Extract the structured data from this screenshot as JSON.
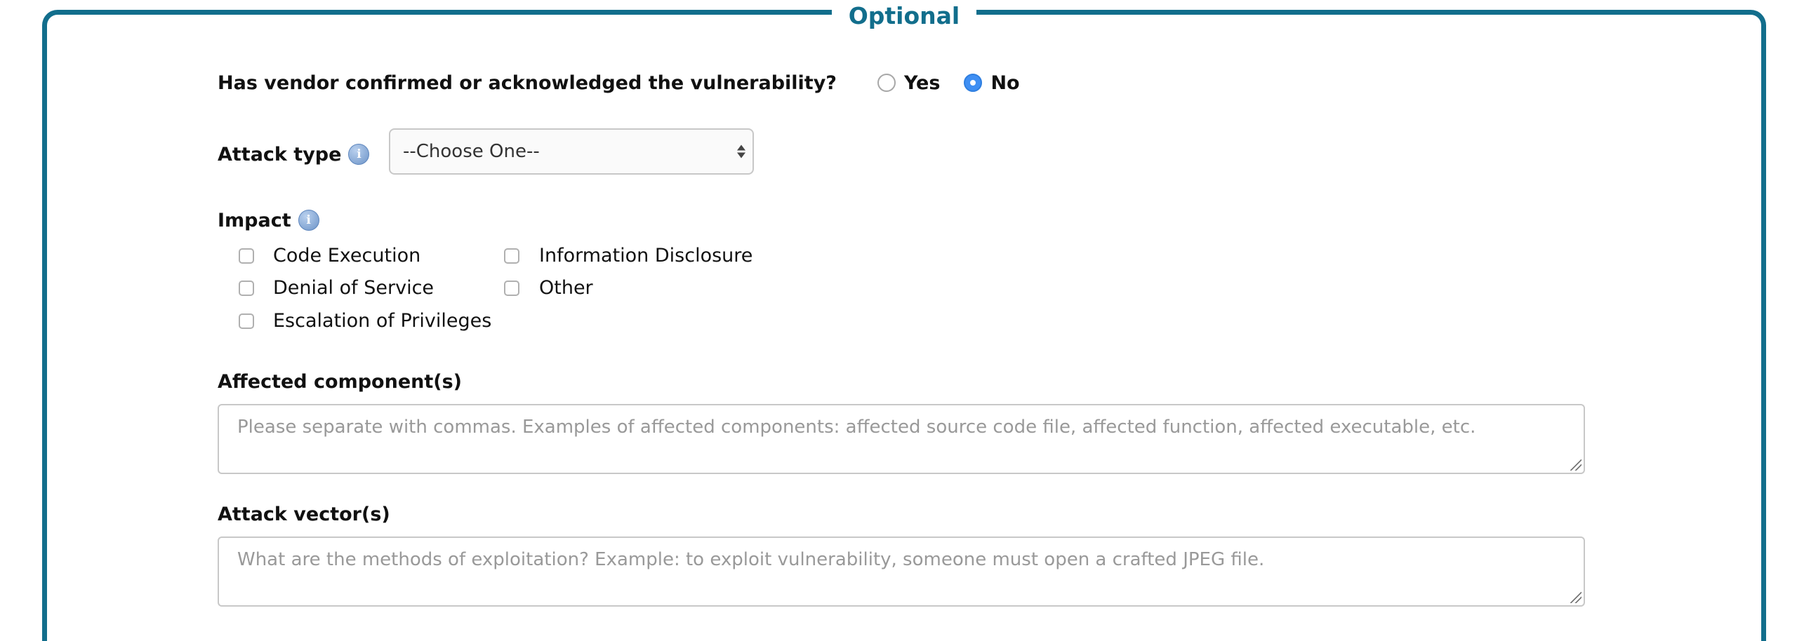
{
  "section": {
    "legend": "Optional"
  },
  "vendor_question": {
    "label": "Has vendor confirmed or acknowledged the vulnerability?",
    "options": [
      {
        "label": "Yes",
        "selected": false
      },
      {
        "label": "No",
        "selected": true
      }
    ]
  },
  "attack_type": {
    "label": "Attack type",
    "info_icon": "info-icon",
    "selected_value": "--Choose One--"
  },
  "impact": {
    "label": "Impact",
    "info_icon": "info-icon",
    "options": [
      {
        "label": "Code Execution",
        "checked": false
      },
      {
        "label": "Denial of Service",
        "checked": false
      },
      {
        "label": "Escalation of Privileges",
        "checked": false
      },
      {
        "label": "Information Disclosure",
        "checked": false
      },
      {
        "label": "Other",
        "checked": false
      }
    ]
  },
  "affected_components": {
    "label": "Affected component(s)",
    "value": "",
    "placeholder": "Please separate with commas. Examples of affected components: affected source code file, affected function, affected executable, etc."
  },
  "attack_vectors": {
    "label": "Attack vector(s)",
    "value": "",
    "placeholder": "What are the methods of exploitation? Example: to exploit vulnerability, someone must open a crafted JPEG file."
  },
  "colors": {
    "accent": "#126e8c",
    "radio_selected": "#3f8ff3"
  }
}
